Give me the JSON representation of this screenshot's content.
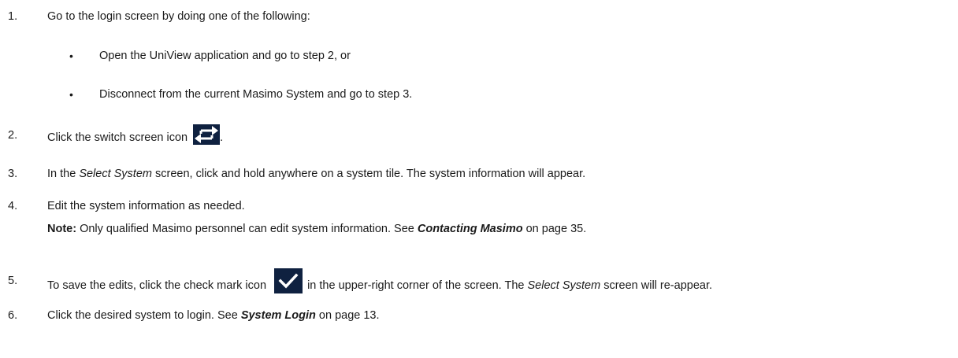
{
  "steps": [
    {
      "number": "1.",
      "text": "Go to the login screen by doing one of the following:",
      "bullets": [
        "Open the UniView application and go to step 2, or",
        "Disconnect from the current Masimo System and go to step 3."
      ]
    },
    {
      "number": "2.",
      "text_before_icon": "Click the switch screen icon",
      "text_after_icon": ".",
      "icon": "switch-screen-icon"
    },
    {
      "number": "3.",
      "text_prefix": "In the ",
      "italic": "Select System",
      "text_suffix": " screen, click and hold anywhere on a system tile. The system information will appear."
    },
    {
      "number": "4.",
      "text": "Edit the system information as needed.",
      "note_label": "Note:",
      "note_text": " Only qualified Masimo personnel can edit system information. See ",
      "note_link": "Contacting Masimo",
      "note_page": " on page 35."
    },
    {
      "number": "5.",
      "text_before_icon": "To save the edits, click the check mark icon",
      "text_after_icon": "in the upper-right corner of the screen. The ",
      "italic": "Select System",
      "text_suffix": " screen will re-appear.",
      "icon": "check-mark-icon"
    },
    {
      "number": "6.",
      "text": "Click the desired system to login. See ",
      "link": "System Login",
      "text_suffix": " on page 13."
    }
  ],
  "bullet_glyph": "•",
  "colors": {
    "icon_background": "#0f2140",
    "text": "#1a1a1a"
  }
}
